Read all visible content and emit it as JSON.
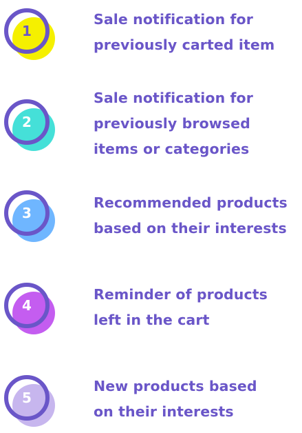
{
  "items": [
    {
      "number": "1",
      "line1": "Sale notification for",
      "line2": "previously carted item",
      "line3": "",
      "fill_color": "#f5f000",
      "number_color": "#6a56c8"
    },
    {
      "number": "2",
      "line1": "Sale notification for",
      "line2": "previously browsed",
      "line3": "items or categories",
      "fill_color": "#45e0d8",
      "number_color": "#ffffff"
    },
    {
      "number": "3",
      "line1": "Recommended products",
      "line2": "based on their interests",
      "line3": "",
      "fill_color": "#6fb6ff",
      "number_color": "#ffffff"
    },
    {
      "number": "4",
      "line1": "Reminder of products",
      "line2": "left in the cart",
      "line3": "",
      "fill_color": "#c45df0",
      "number_color": "#ffffff"
    },
    {
      "number": "5",
      "line1": "New products based",
      "line2": "on their interests",
      "line3": "",
      "fill_color": "#c7b6ee",
      "number_color": "#ffffff"
    }
  ],
  "ring_color": "#6a56c8",
  "text_color": "#6a56c8"
}
